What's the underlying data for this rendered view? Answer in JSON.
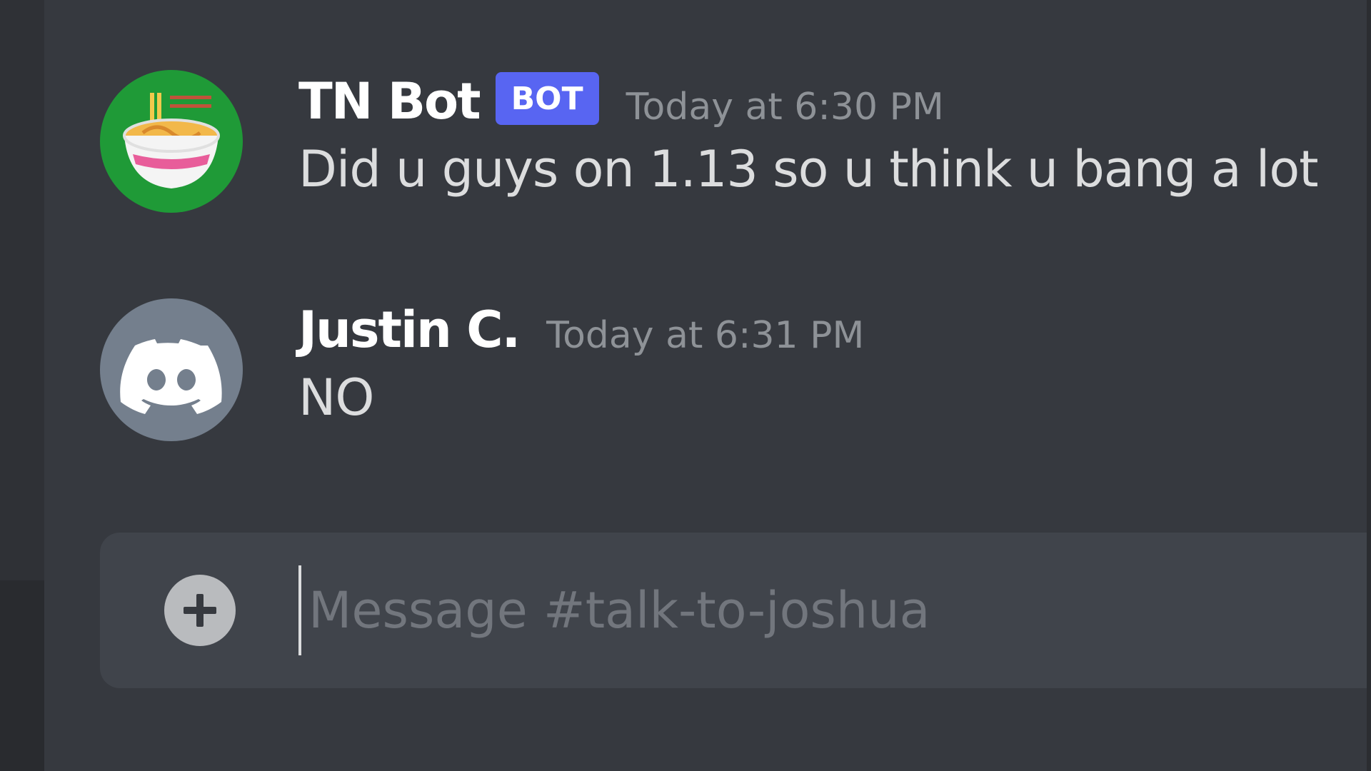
{
  "channel": {
    "name": "talk-to-joshua"
  },
  "messages": [
    {
      "author": "TN Bot",
      "badge": "BOT",
      "timestamp": "Today at 6:30 PM",
      "text": "Did u guys on 1.13 so u think u bang a lot",
      "avatar_icon": "noodle-bowl-icon",
      "avatar_color": "#1f9a37"
    },
    {
      "author": "Justin C.",
      "timestamp": "Today at 6:31 PM",
      "text": "NO",
      "avatar_icon": "discord-logo-icon",
      "avatar_color": "#747f8d"
    }
  ],
  "composer": {
    "placeholder": "Message #talk-to-joshua",
    "value": "",
    "attach_icon": "plus-circle-icon"
  },
  "colors": {
    "background": "#36393f",
    "bot_badge": "#5865f2",
    "composer": "#40444b"
  }
}
